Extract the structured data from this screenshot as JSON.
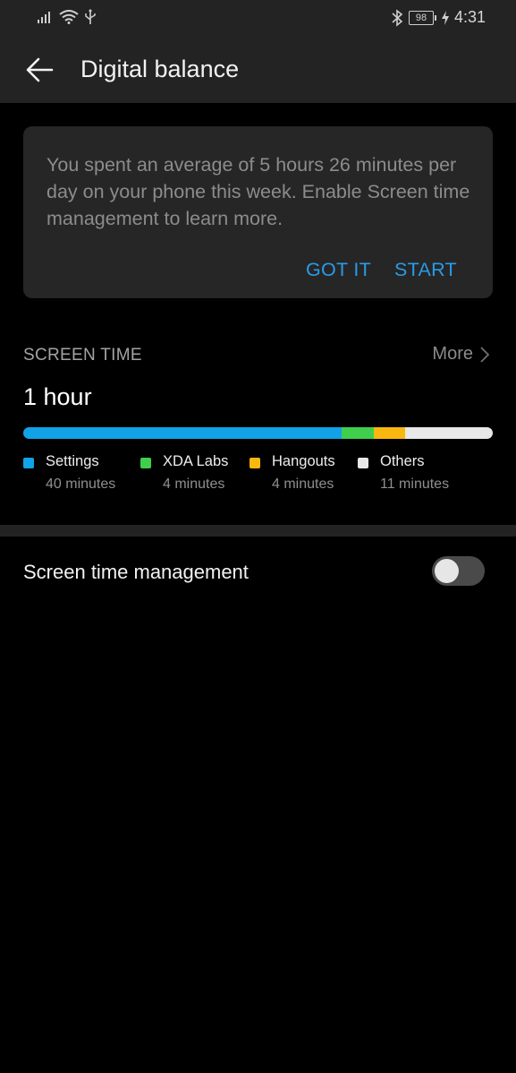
{
  "status_bar": {
    "time": "4:31",
    "battery_level": "98",
    "icons": [
      "signal-icon",
      "wifi-icon",
      "usb-icon",
      "bluetooth-icon",
      "battery-icon",
      "charging-icon"
    ]
  },
  "app_bar": {
    "title": "Digital balance",
    "back_icon": "arrow-left-icon"
  },
  "notice": {
    "text": "You spent an average of 5 hours 26 minutes per day on your phone this week. Enable Screen time management to learn more.",
    "got_it_label": "GOT IT",
    "start_label": "START",
    "accent_color": "#2b9be6"
  },
  "screen_time": {
    "section_title": "SCREEN TIME",
    "more_label": "More",
    "total": "1 hour",
    "apps": [
      {
        "name": "Settings",
        "minutes_label": "40 minutes",
        "minutes": 40,
        "color": "#12a2e8"
      },
      {
        "name": "XDA Labs",
        "minutes_label": "4 minutes",
        "minutes": 4,
        "color": "#3fcf4d"
      },
      {
        "name": "Hangouts",
        "minutes_label": "4 minutes",
        "minutes": 4,
        "color": "#f9b80f"
      },
      {
        "name": "Others",
        "minutes_label": "11 minutes",
        "minutes": 11,
        "color": "#e8e8e8"
      }
    ]
  },
  "management": {
    "label": "Screen time management",
    "enabled": false
  }
}
